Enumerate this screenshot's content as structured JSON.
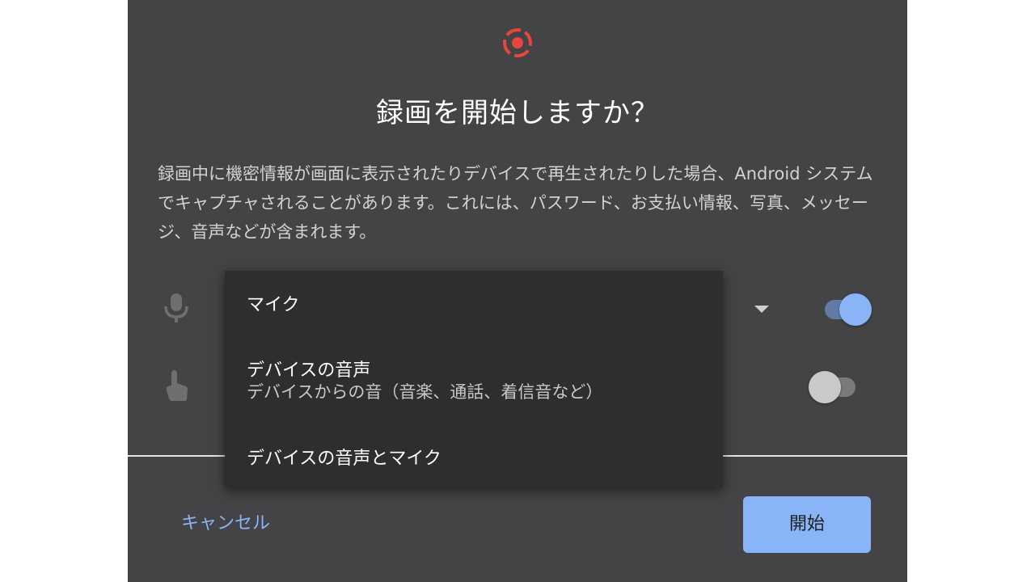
{
  "dialog": {
    "title": "録画を開始しますか？",
    "description": "録画中に機密情報が画面に表示されたりデバイスで再生されたりした場合、Android システムでキャプチャされることがあります。これには、パスワード、お支払い情報、写真、メッセージ、音声などが含まれます。",
    "record_icon": "screen-record-icon",
    "accent_color": "#e8453c",
    "rows": [
      {
        "icon": "mic-icon",
        "toggle_on": true
      },
      {
        "icon": "touch-icon",
        "toggle_on": false
      }
    ],
    "cancel_label": "キャンセル",
    "start_label": "開始"
  },
  "audio_menu": {
    "items": [
      {
        "label": "マイク"
      },
      {
        "label": "デバイスの音声",
        "sublabel": "デバイスからの音（音楽、通話、着信音など）"
      },
      {
        "label": "デバイスの音声とマイク"
      }
    ]
  },
  "colors": {
    "dialog_bg": "#444446",
    "menu_bg": "#2e2e2e",
    "primary": "#8ab4f8"
  }
}
